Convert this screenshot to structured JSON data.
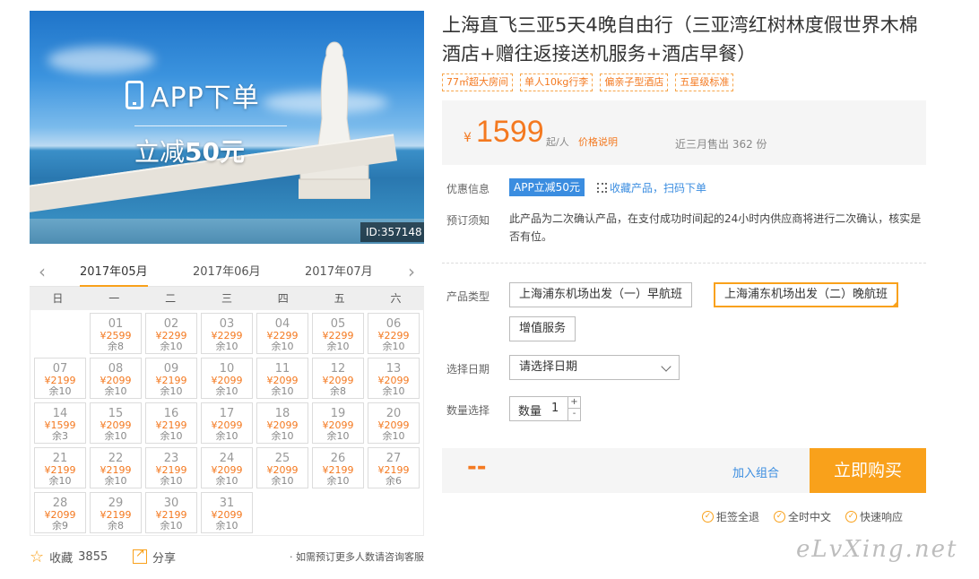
{
  "hero": {
    "app_label": "APP下单",
    "discount_label": "立减",
    "discount_amount": "50元",
    "image_id": "ID:357148"
  },
  "calendar": {
    "months": [
      "2017年05月",
      "2017年06月",
      "2017年07月"
    ],
    "active_month": "2017年05月",
    "weekdays": [
      "日",
      "一",
      "二",
      "三",
      "四",
      "五",
      "六"
    ],
    "days": [
      {
        "day": "01",
        "price": "¥2599",
        "stock": "余8"
      },
      {
        "day": "02",
        "price": "¥2299",
        "stock": "余10"
      },
      {
        "day": "03",
        "price": "¥2299",
        "stock": "余10"
      },
      {
        "day": "04",
        "price": "¥2299",
        "stock": "余10"
      },
      {
        "day": "05",
        "price": "¥2299",
        "stock": "余10"
      },
      {
        "day": "06",
        "price": "¥2299",
        "stock": "余10"
      },
      {
        "day": "07",
        "price": "¥2199",
        "stock": "余10"
      },
      {
        "day": "08",
        "price": "¥2099",
        "stock": "余10"
      },
      {
        "day": "09",
        "price": "¥2199",
        "stock": "余10"
      },
      {
        "day": "10",
        "price": "¥2099",
        "stock": "余10"
      },
      {
        "day": "11",
        "price": "¥2099",
        "stock": "余10"
      },
      {
        "day": "12",
        "price": "¥2099",
        "stock": "余8"
      },
      {
        "day": "13",
        "price": "¥2099",
        "stock": "余10"
      },
      {
        "day": "14",
        "price": "¥1599",
        "stock": "余3"
      },
      {
        "day": "15",
        "price": "¥2099",
        "stock": "余10"
      },
      {
        "day": "16",
        "price": "¥2199",
        "stock": "余10"
      },
      {
        "day": "17",
        "price": "¥2099",
        "stock": "余10"
      },
      {
        "day": "18",
        "price": "¥2099",
        "stock": "余10"
      },
      {
        "day": "19",
        "price": "¥2099",
        "stock": "余10"
      },
      {
        "day": "20",
        "price": "¥2099",
        "stock": "余10"
      },
      {
        "day": "21",
        "price": "¥2199",
        "stock": "余10"
      },
      {
        "day": "22",
        "price": "¥2199",
        "stock": "余10"
      },
      {
        "day": "23",
        "price": "¥2199",
        "stock": "余10"
      },
      {
        "day": "24",
        "price": "¥2099",
        "stock": "余10"
      },
      {
        "day": "25",
        "price": "¥2099",
        "stock": "余10"
      },
      {
        "day": "26",
        "price": "¥2199",
        "stock": "余10"
      },
      {
        "day": "27",
        "price": "¥2199",
        "stock": "余6"
      },
      {
        "day": "28",
        "price": "¥2099",
        "stock": "余9"
      },
      {
        "day": "29",
        "price": "¥2199",
        "stock": "余8"
      },
      {
        "day": "30",
        "price": "¥2199",
        "stock": "余10"
      },
      {
        "day": "31",
        "price": "¥2099",
        "stock": "余10"
      }
    ]
  },
  "actions": {
    "favorite_label": "收藏",
    "favorite_count": "3855",
    "share_label": "分享",
    "consult_note": "· 如需预订更多人数请咨询客服"
  },
  "product": {
    "title": "上海直飞三亚5天4晚自由行（三亚湾红树林度假世界木棉酒店+赠往返接送机服务+酒店早餐）",
    "tags": [
      "77㎡超大房间",
      "单人10kg行李",
      "偏亲子型酒店",
      "五星级标准"
    ],
    "currency": "¥",
    "price": "1599",
    "price_unit": "起/人",
    "price_note": "价格说明",
    "sold": "近三月售出 362 份",
    "promo_label": "优惠信息",
    "promo_badge": "APP立减50元",
    "qr_link": "收藏产品，扫码下单",
    "notice_label": "预订须知",
    "notice_text": "此产品为二次确认产品，在支付成功时间起的24小时内供应商将进行二次确认，核实是否有位。",
    "type_label": "产品类型",
    "type_options": [
      "上海浦东机场出发（一）早航班",
      "上海浦东机场出发（二）晚航班",
      "增值服务"
    ],
    "date_label": "选择日期",
    "date_placeholder": "请选择日期",
    "qty_label": "数量选择",
    "qty_prefix": "数量",
    "qty_value": "1",
    "qty_plus": "+",
    "qty_minus": "-",
    "total": "--",
    "add_combo": "加入组合",
    "buy_now": "立即购买",
    "guarantees": [
      "拒签全退",
      "全时中文",
      "快速响应"
    ]
  },
  "watermark": "eLvXing.net",
  "colors": {
    "accent": "#f9a11b",
    "price": "#f47920",
    "link": "#3b8de0"
  }
}
